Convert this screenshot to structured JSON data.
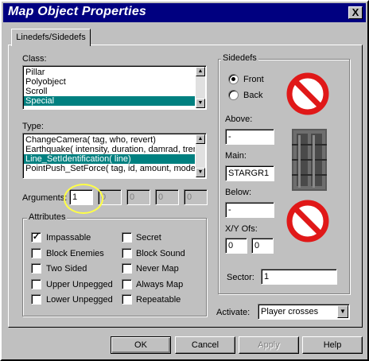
{
  "window": {
    "title": "Map Object Properties",
    "close_glyph": "X"
  },
  "tab": {
    "label": "Linedefs/Sidedefs"
  },
  "class_section": {
    "label": "Class:",
    "items": [
      "Pillar",
      "Polyobject",
      "Scroll",
      "Special"
    ],
    "selected_index": 3
  },
  "type_section": {
    "label": "Type:",
    "items": [
      "ChangeCamera( tag, who, revert)",
      "Earthquake( intensity, duration, damrad, tremr",
      "Line_SetIdentification( line)",
      "PointPush_SetForce( tag, id, amount, model)"
    ],
    "selected_index": 2
  },
  "arguments": {
    "label": "Arguments:",
    "values": [
      "1",
      "0",
      "0",
      "0",
      "0"
    ]
  },
  "attributes": {
    "title": "Attributes",
    "items": [
      {
        "label": "Impassable",
        "checked": true
      },
      {
        "label": "Block Enemies",
        "checked": false
      },
      {
        "label": "Two Sided",
        "checked": false
      },
      {
        "label": "Upper Unpegged",
        "checked": false
      },
      {
        "label": "Lower Unpegged",
        "checked": false
      },
      {
        "label": "Secret",
        "checked": false
      },
      {
        "label": "Block Sound",
        "checked": false
      },
      {
        "label": "Never Map",
        "checked": false
      },
      {
        "label": "Always Map",
        "checked": false
      },
      {
        "label": "Repeatable",
        "checked": false
      }
    ]
  },
  "sidedefs": {
    "title": "Sidedefs",
    "front_label": "Front",
    "back_label": "Back",
    "selected": "Front",
    "above_label": "Above:",
    "above_value": "-",
    "main_label": "Main:",
    "main_value": "STARGR1",
    "below_label": "Below:",
    "below_value": "-",
    "xy_label": "X/Y Ofs:",
    "x_value": "0",
    "y_value": "0",
    "sector_label": "Sector:",
    "sector_value": "1"
  },
  "activate": {
    "label": "Activate:",
    "value": "Player crosses"
  },
  "buttons": {
    "ok": "OK",
    "cancel": "Cancel",
    "apply": "Apply",
    "help": "Help"
  },
  "colors": {
    "titlebar": "#000080",
    "selection": "#008080",
    "face": "#c0c0c0",
    "no_texture": "#e01818"
  }
}
